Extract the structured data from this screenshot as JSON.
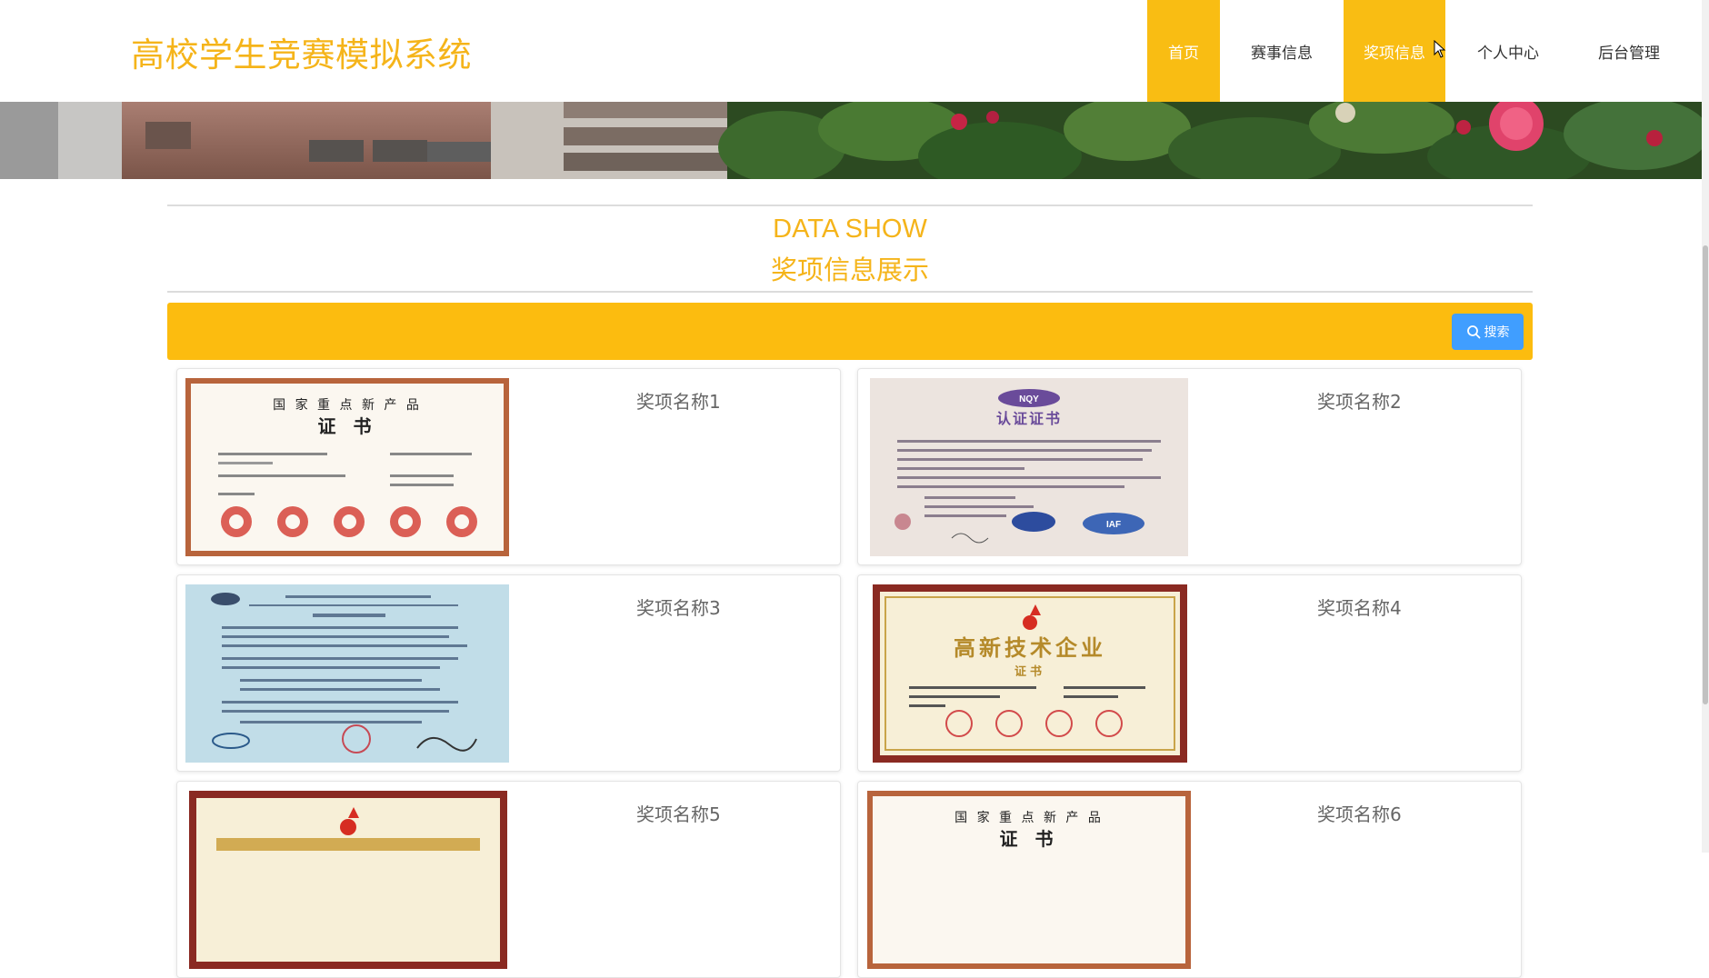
{
  "header": {
    "logo": "高校学生竞赛模拟系统",
    "nav": [
      {
        "label": "首页",
        "active": true
      },
      {
        "label": "赛事信息",
        "active": false
      },
      {
        "label": "奖项信息",
        "active": true
      },
      {
        "label": "个人中心",
        "active": false
      },
      {
        "label": "后台管理",
        "active": false
      }
    ]
  },
  "section": {
    "title_en": "DATA SHOW",
    "title_cn": "奖项信息展示"
  },
  "search": {
    "button_label": "搜索"
  },
  "awards": [
    {
      "name": "奖项名称1"
    },
    {
      "name": "奖项名称2"
    },
    {
      "name": "奖项名称3"
    },
    {
      "name": "奖项名称4"
    },
    {
      "name": "奖项名称5"
    },
    {
      "name": "奖项名称6"
    }
  ],
  "certificates": {
    "c1_line1": "国 家 重 点 新 产 品",
    "c1_line2": "证 书",
    "c2_brand": "NQY",
    "c2_title": "认证证书",
    "c2_logo": "IAF",
    "c4_title": "高新技术企业",
    "c4_sub": "证书",
    "c6_line1": "国 家 重 点 新 产 品",
    "c6_line2": "证 书"
  },
  "colors": {
    "accent": "#f9bd13",
    "search_bar": "#fcbc0f",
    "search_button": "#409eff",
    "title": "#f5b41a"
  }
}
